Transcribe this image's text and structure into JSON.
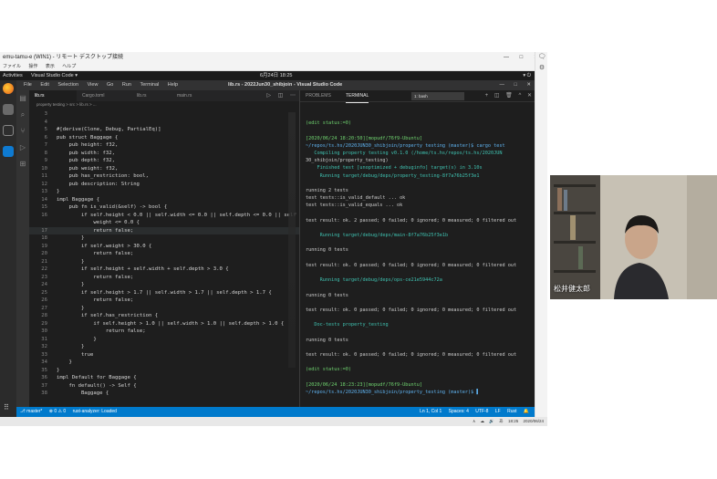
{
  "remote_window": {
    "title": "emu-tamu-e (WIN1) - リモート デスクトップ接続",
    "menu": [
      "ファイル",
      "操作",
      "表示",
      "ヘルプ"
    ],
    "controls": [
      "—",
      "□",
      "✕"
    ]
  },
  "ubuntu_bar": {
    "activities": "Activities",
    "app": "Visual Studio Code ▾",
    "clock": "6月24日 18:25",
    "tray": "▾ ⏻"
  },
  "vscode": {
    "title": "lib.rs - 2022Jun30_shibjoin - Visual Studio Code",
    "menu": [
      "File",
      "Edit",
      "Selection",
      "View",
      "Go",
      "Run",
      "Terminal",
      "Help"
    ],
    "window_controls": [
      "—",
      "□",
      "✕"
    ],
    "tabs": [
      {
        "label": "lib.rs"
      },
      {
        "label": "Cargo.toml"
      },
      {
        "label": "lib.rs"
      },
      {
        "label": "main.rs"
      }
    ],
    "tab_actions": [
      "▷",
      "◫",
      "⋯"
    ],
    "breadcrumb": "property testing > src > lib.rs > ...",
    "code": [
      {
        "n": "3",
        "t": ""
      },
      {
        "n": "4",
        "t": ""
      },
      {
        "n": "5",
        "t": "#[derive(Clone, Debug, PartialEq)]"
      },
      {
        "n": "6",
        "t": "pub struct Baggage {"
      },
      {
        "n": "7",
        "t": "    pub height: f32,"
      },
      {
        "n": "8",
        "t": "    pub width: f32,"
      },
      {
        "n": "9",
        "t": "    pub depth: f32,"
      },
      {
        "n": "10",
        "t": "    pub weight: f32,"
      },
      {
        "n": "11",
        "t": "    pub has_restriction: bool,"
      },
      {
        "n": "12",
        "t": "    pub description: String"
      },
      {
        "n": "13",
        "t": "}"
      },
      {
        "n": "14",
        "t": "impl Baggage {"
      },
      {
        "n": "15",
        "t": "    pub fn is_valid(&self) -> bool {"
      },
      {
        "n": "16",
        "t": "        if self.height < 0.0 || self.width <= 0.0 || self.depth <= 0.0 || self"
      },
      {
        "n": "",
        "t": "            weight <= 0.0 {"
      },
      {
        "n": "17",
        "t": "            return false;"
      },
      {
        "n": "18",
        "t": "        }"
      },
      {
        "n": "19",
        "t": "        if self.weight > 30.0 {"
      },
      {
        "n": "20",
        "t": "            return false;"
      },
      {
        "n": "21",
        "t": "        }"
      },
      {
        "n": "22",
        "t": "        if self.height + self.width + self.depth > 3.0 {"
      },
      {
        "n": "23",
        "t": "            return false;"
      },
      {
        "n": "24",
        "t": "        }"
      },
      {
        "n": "25",
        "t": "        if self.height > 1.7 || self.width > 1.7 || self.depth > 1.7 {"
      },
      {
        "n": "26",
        "t": "            return false;"
      },
      {
        "n": "27",
        "t": "        }"
      },
      {
        "n": "28",
        "t": "        if self.has_restriction {"
      },
      {
        "n": "29",
        "t": "            if self.height > 1.0 || self.width > 1.0 || self.depth > 1.0 {"
      },
      {
        "n": "30",
        "t": "                return false;"
      },
      {
        "n": "31",
        "t": "            }"
      },
      {
        "n": "32",
        "t": "        }"
      },
      {
        "n": "33",
        "t": "        true"
      },
      {
        "n": "34",
        "t": "    }"
      },
      {
        "n": "35",
        "t": "}"
      },
      {
        "n": "36",
        "t": "impl Default for Baggage {"
      },
      {
        "n": "37",
        "t": "    fn default() -> Self {"
      },
      {
        "n": "38",
        "t": "        Baggage {"
      }
    ],
    "panel_tabs": [
      "PROBLEMS",
      "TERMINAL"
    ],
    "terminal_select": "1: bash",
    "panel_actions": [
      "+",
      "◫",
      "🗑",
      "^",
      "✕"
    ],
    "terminal": [
      "",
      "(edit status:=0)",
      "",
      "[2020/06/24 18:20:50][mopudf/76f9-Ubuntu]",
      "~/repos/ts.hs/2020JUN30_shibjoin/property testing (master)$ cargo test",
      "   Compiling property testing v0.1.0 (/home/ts.hs/repos/ts.hs/2020JUN",
      "30_shibjoin/property_testing)",
      "    Finished test [unoptimized + debuginfo] target(s) in 3.10s",
      "     Running target/debug/deps/property_testing-8f7a76b25f3e1",
      "",
      "running 2 tests",
      "test tests::is_valid_default ... ok",
      "test tests::is_valid_equals ... ok",
      "",
      "test result: ok. 2 passed; 0 failed; 0 ignored; 0 measured; 0 filtered out",
      "",
      "     Running target/debug/deps/main-8f7a76b25f3e1b",
      "",
      "running 0 tests",
      "",
      "test result: ok. 0 passed; 0 failed; 0 ignored; 0 measured; 0 filtered out",
      "",
      "     Running target/debug/deps/ops-ce21e5944c72a",
      "",
      "running 0 tests",
      "",
      "test result: ok. 0 passed; 0 failed; 0 ignored; 0 measured; 0 filtered out",
      "",
      "   Doc-tests property_testing",
      "",
      "running 0 tests",
      "",
      "test result: ok. 0 passed; 0 failed; 0 ignored; 0 measured; 0 filtered out",
      "",
      "(edit status:=0)",
      "",
      "[2020/06/24 18:23:23][mopudf/76f9-Ubuntu]",
      "~/repos/ts.hs/2020JUN30_shibjoin/property_testing (master)$ ▌"
    ],
    "status_left": [
      "⎇ master*",
      "⊗ 0 ⚠ 0",
      "rust-analyzer: Loaded"
    ],
    "status_right": [
      "Ln 1, Col 1",
      "Spaces: 4",
      "UTF-8",
      "LF",
      "Rust",
      "🔔"
    ]
  },
  "win_taskbar": {
    "tray": [
      "∧",
      "☁",
      "🔊",
      "あ",
      "18:25",
      "2020/06/24"
    ]
  },
  "webcam": {
    "name": "松井健太郎"
  }
}
